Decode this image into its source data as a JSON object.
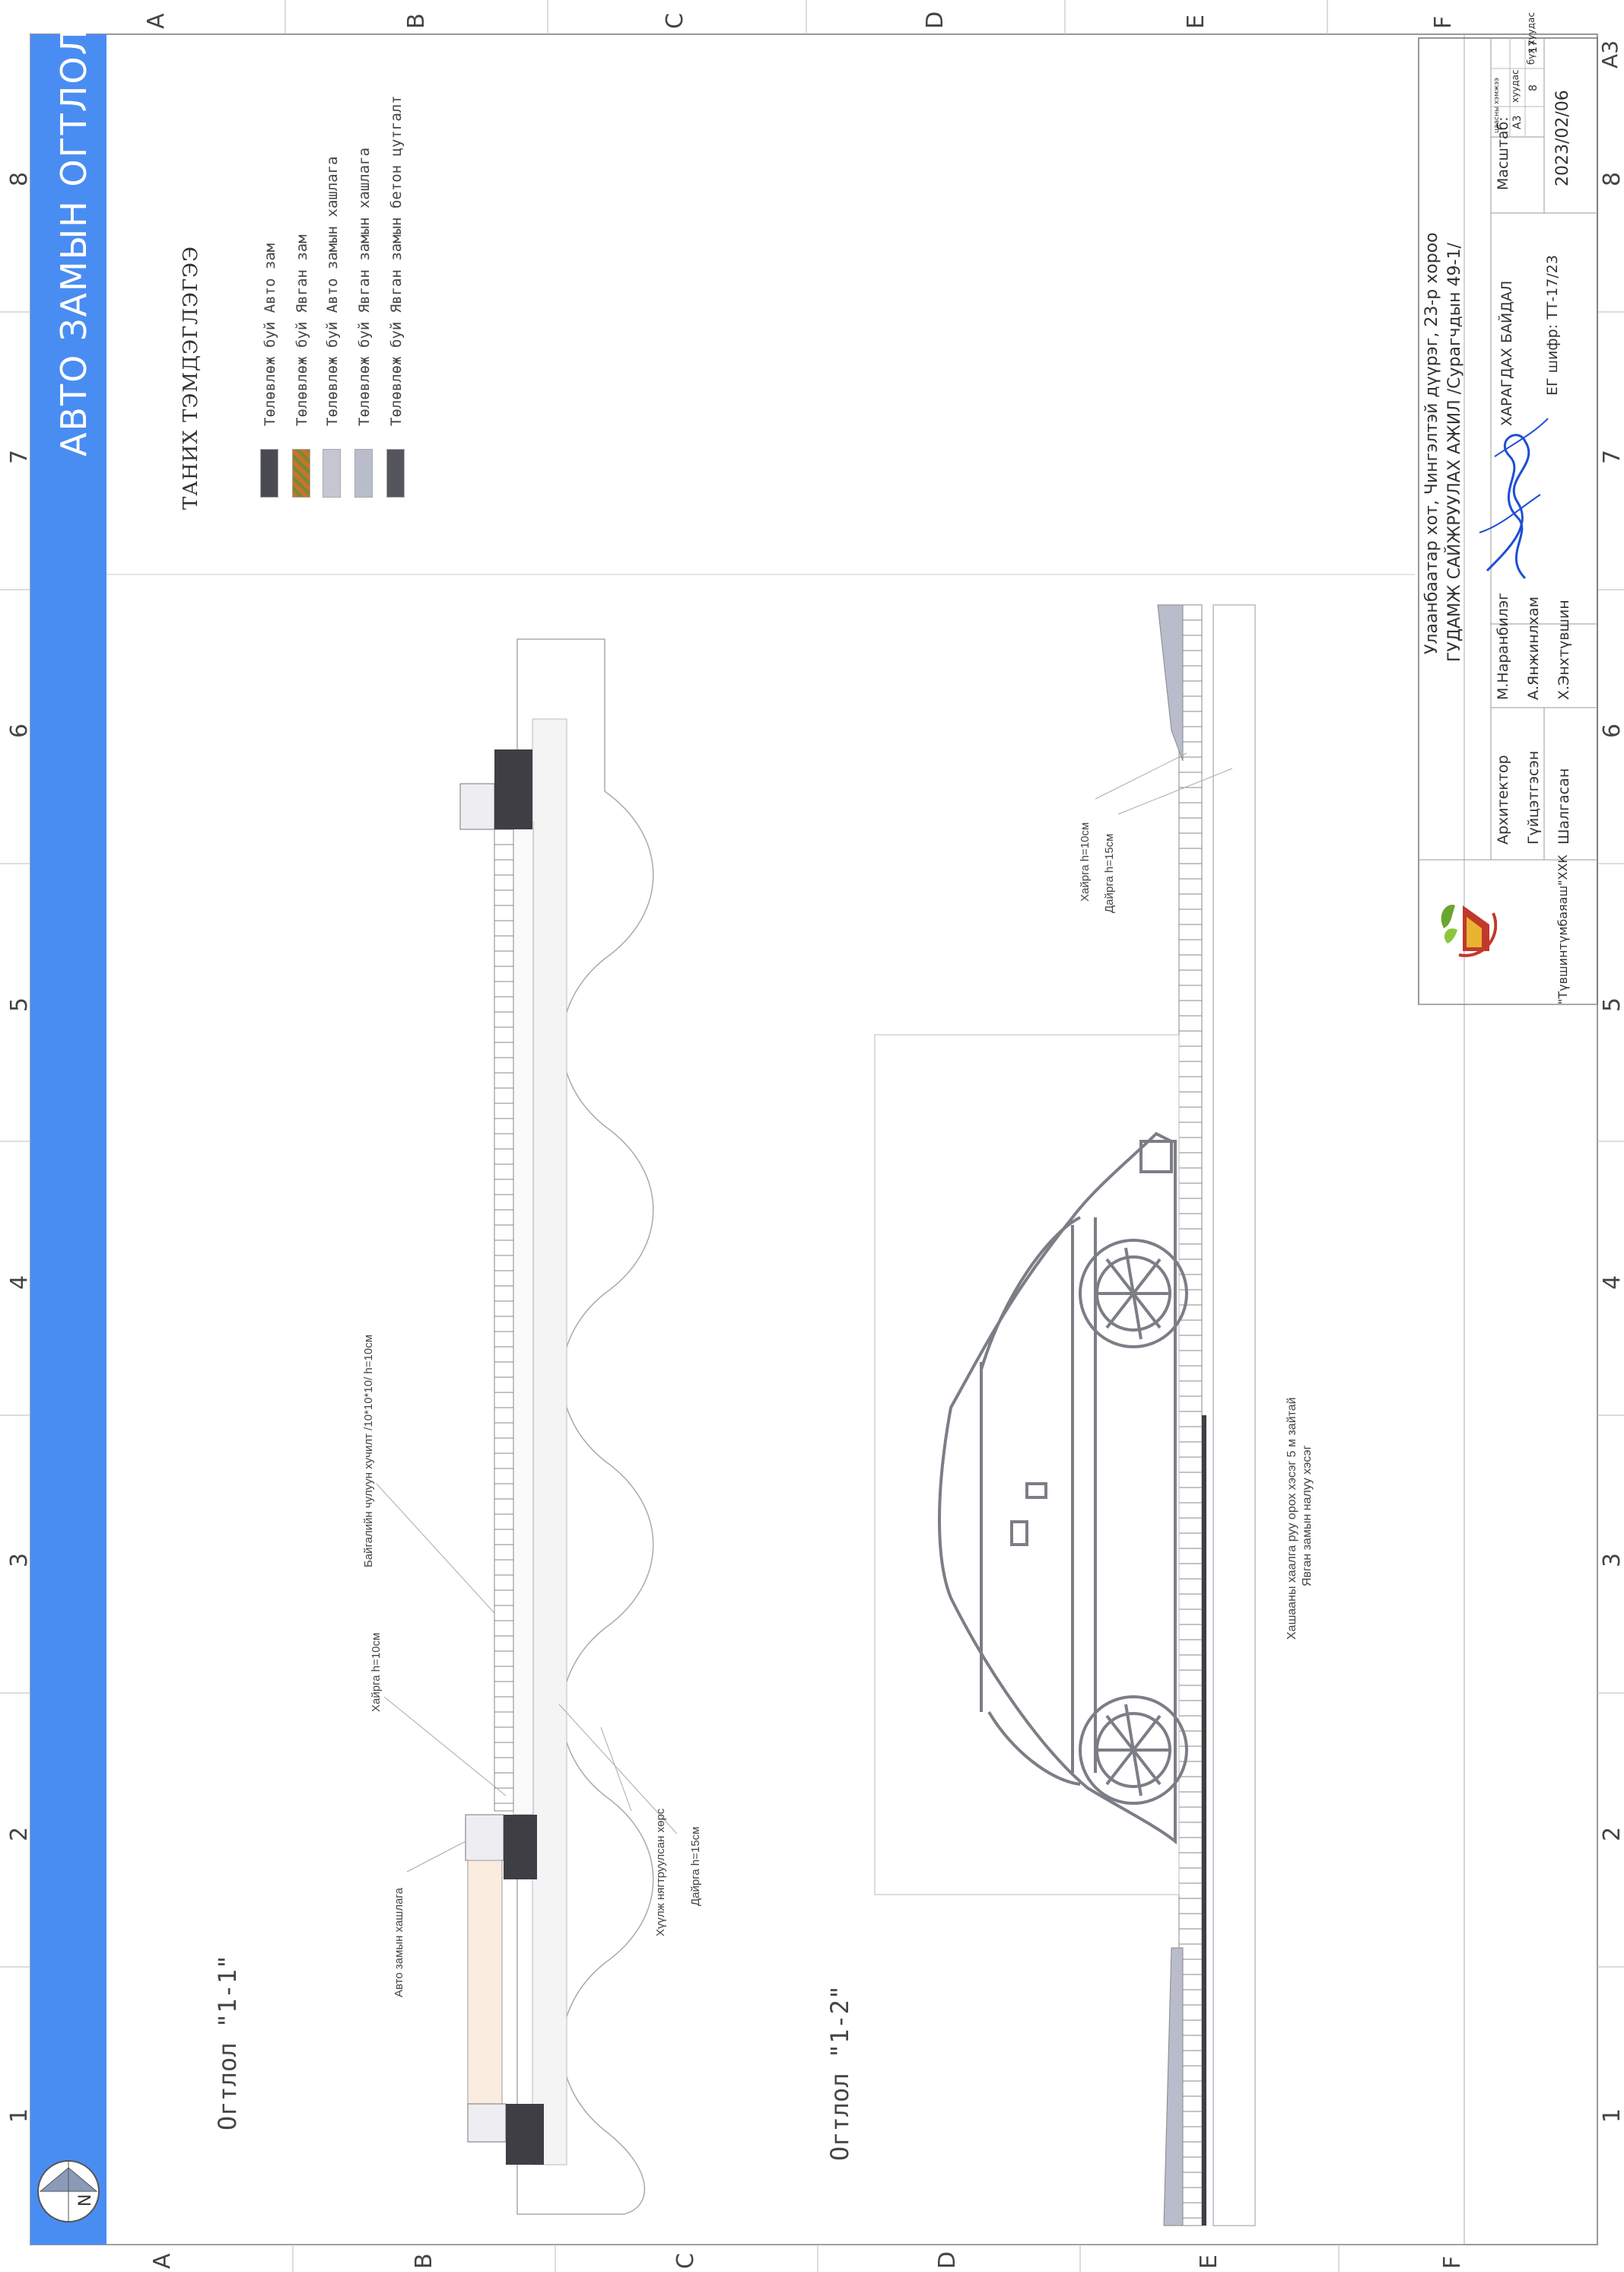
{
  "sheet_title": "АВТО ЗАМЫН ОГТЛОЛ",
  "grid": {
    "numbers": [
      "1",
      "2",
      "3",
      "4",
      "5",
      "6",
      "7",
      "8"
    ],
    "letters": [
      "A",
      "B",
      "C",
      "D",
      "E",
      "F"
    ]
  },
  "legend": {
    "title": "ТАНИХ ТЭМДЭГЛЭГЭЭ",
    "items": [
      {
        "label": "Төлөвлөж буй Авто зам",
        "color": "#4a4a52"
      },
      {
        "label": "Төлөвлөж буй Явган зам",
        "color": "#c8722e"
      },
      {
        "label": "Төлөвлөж буй Авто замын хашлага",
        "color": "#c4c6d2"
      },
      {
        "label": "Төлөвлөж буй Явган замын хашлага",
        "color": "#b9bccb"
      },
      {
        "label": "Төлөвлөж буй Явган замын бетон цутгалт",
        "color": "#55555e"
      }
    ]
  },
  "section1": {
    "title": "Огтлол \"1-1\"",
    "ann_paving": "Байгалийн чулуун хучилт /10*10*10/ h=10см",
    "ann_sand": "Хайрга h=10см",
    "ann_curb": "Авто замын хашлага",
    "ann_soil": "Хүүлж нягтруулсан хөрс",
    "ann_gravel": "Дайрга h=15см"
  },
  "section2": {
    "title": "Огтлол \"1-2\"",
    "ann_sand": "Хайрга h=10см",
    "ann_gravel": "Дайрга h=15см",
    "ann_slope_1": "Хашааны хаалга руу орох хэсэг 5 м зайтай",
    "ann_slope_2": "Явган замын налуу хэсэг"
  },
  "north_label": "N",
  "title_block": {
    "company": "\"Түвшинтүмбаяаш\"ХХК",
    "location": "Улаанбаатар хот, Чингэлтэй дүүрэг, 23-р хороо",
    "project": "ГУДАМЖ САЙЖРУУЛАХ АЖИЛ /Сурагчдын 49-1/",
    "roles": [
      {
        "role": "Архитектор",
        "name": "М.Наранбилэг"
      },
      {
        "role": "Гүйцэтгэсэн",
        "name": "А.Янжинлхам"
      },
      {
        "role": "Шалгасан",
        "name": "Х.Энхтүвшин"
      }
    ],
    "drawing_name": "ХАРАГДАХ БАЙДАЛ",
    "code": "ЕГ шифр: ТТ-17/23",
    "scale_label": "Масштаб:",
    "sheet_size_label": "цаасны хэмжээ",
    "sheet_label": "хуудас",
    "total_label": "бүх хуудас",
    "sheet_size": "A3",
    "sheet_no": "8",
    "sheet_total": "17",
    "date": "2023/02/06",
    "corner_size": "A3"
  },
  "colors": {
    "title_bar": "#4a8df2",
    "line": "#8a8a8a",
    "car": "#7c7e86",
    "curb": "#3e3e44"
  }
}
